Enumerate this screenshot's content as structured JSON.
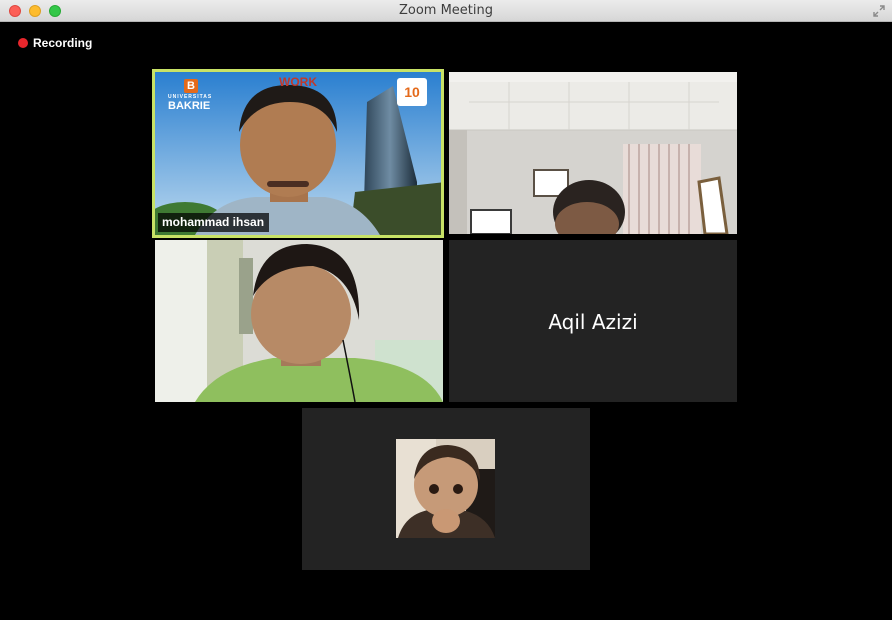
{
  "window": {
    "title": "Zoom Meeting"
  },
  "recording": {
    "label": "Recording"
  },
  "participants": [
    {
      "name": "mohammad ihsan",
      "active_speaker": true,
      "video": "on",
      "background": {
        "university_line1": "UNIVERSITAS",
        "university_line2": "BAKRIE",
        "logo_b": "B",
        "event_logo": "WORK",
        "badge": "10"
      }
    },
    {
      "name": "",
      "video": "on"
    },
    {
      "name": "",
      "video": "on"
    },
    {
      "name": "Aqil Azizi",
      "video": "off"
    },
    {
      "name": "",
      "video": "off",
      "avatar": "baby-photo"
    }
  ],
  "colors": {
    "active_border": "#c8e266",
    "recording_dot": "#e8262c",
    "tile_off_bg": "#232323"
  }
}
